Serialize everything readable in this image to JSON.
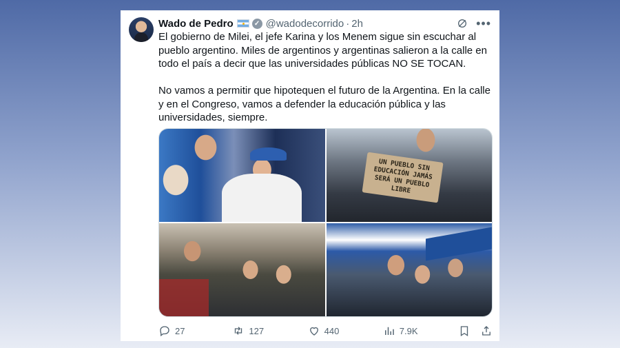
{
  "tweet": {
    "author_name": "Wado de Pedro",
    "handle": "@wadodecorrido",
    "separator": "·",
    "time": "2h",
    "paragraphs": [
      "El gobierno de Milei, el jefe Karina y los Menem sigue sin escuchar al pueblo argentino. Miles de argentinos y argentinas salieron a la calle en todo el país a decir que las universidades públicas NO SE TOCAN.",
      "No vamos a permitir que hipotequen el futuro de la Argentina. En la calle y en el Congreso, vamos a defender la educación pública y las universidades, siempre."
    ],
    "sign_text": "UN PUEBLO SIN EDUCACIÓN JAMÁS SERÁ UN PUEBLO LIBRE",
    "stats": {
      "replies": "27",
      "retweets": "127",
      "likes": "440",
      "views": "7.9K"
    }
  },
  "icons": {
    "verified": "verified-badge-icon",
    "flag": "argentina-flag-icon",
    "grok": "grok-icon",
    "more": "more-icon",
    "reply": "reply-icon",
    "retweet": "retweet-icon",
    "like": "like-icon",
    "views": "views-icon",
    "bookmark": "bookmark-icon",
    "share": "share-icon"
  },
  "colors": {
    "text_primary": "#0f1419",
    "text_secondary": "#536471",
    "flag_blue": "#74acdf"
  }
}
